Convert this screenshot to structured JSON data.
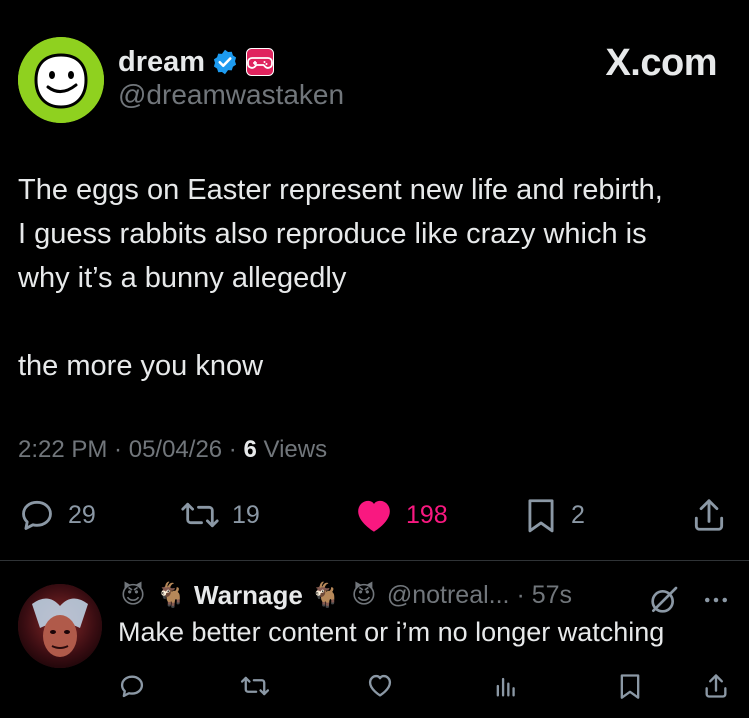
{
  "tweet": {
    "display_name": "dream",
    "handle": "@dreamwastaken",
    "brand": "X.com",
    "text_lines": [
      "The eggs on Easter represent new life and rebirth,",
      "I guess rabbits also reproduce like crazy which is",
      "why it’s a bunny allegedly"
    ],
    "text_tail": "the more you know",
    "time": "2:22 PM",
    "sep1": " · ",
    "date": "05/04/26",
    "sep2": " · ",
    "views_count": "6",
    "views_label": " Views",
    "replies": "29",
    "reposts": "19",
    "likes": "198",
    "bookmarks": "2"
  },
  "reply": {
    "display_name": "Warnage",
    "handle": "@notreal...",
    "sep": " · ",
    "time": "57s",
    "text": "Make better content or i’m no longer watching",
    "emoji_prefix": [
      "😈",
      "🐐"
    ],
    "emoji_suffix": [
      "🐐",
      "😈"
    ]
  },
  "colors": {
    "verified": "#1d9bf0",
    "liked": "#f91880",
    "badge_red": "#e0245e",
    "avatar_green": "#8fd11f",
    "muted": "#71767b"
  },
  "icons": [
    "verified-badge-icon",
    "gamepad-badge-icon",
    "reply-icon",
    "repost-icon",
    "like-icon",
    "bookmark-icon",
    "share-icon",
    "views-icon",
    "grok-icon",
    "more-icon"
  ]
}
